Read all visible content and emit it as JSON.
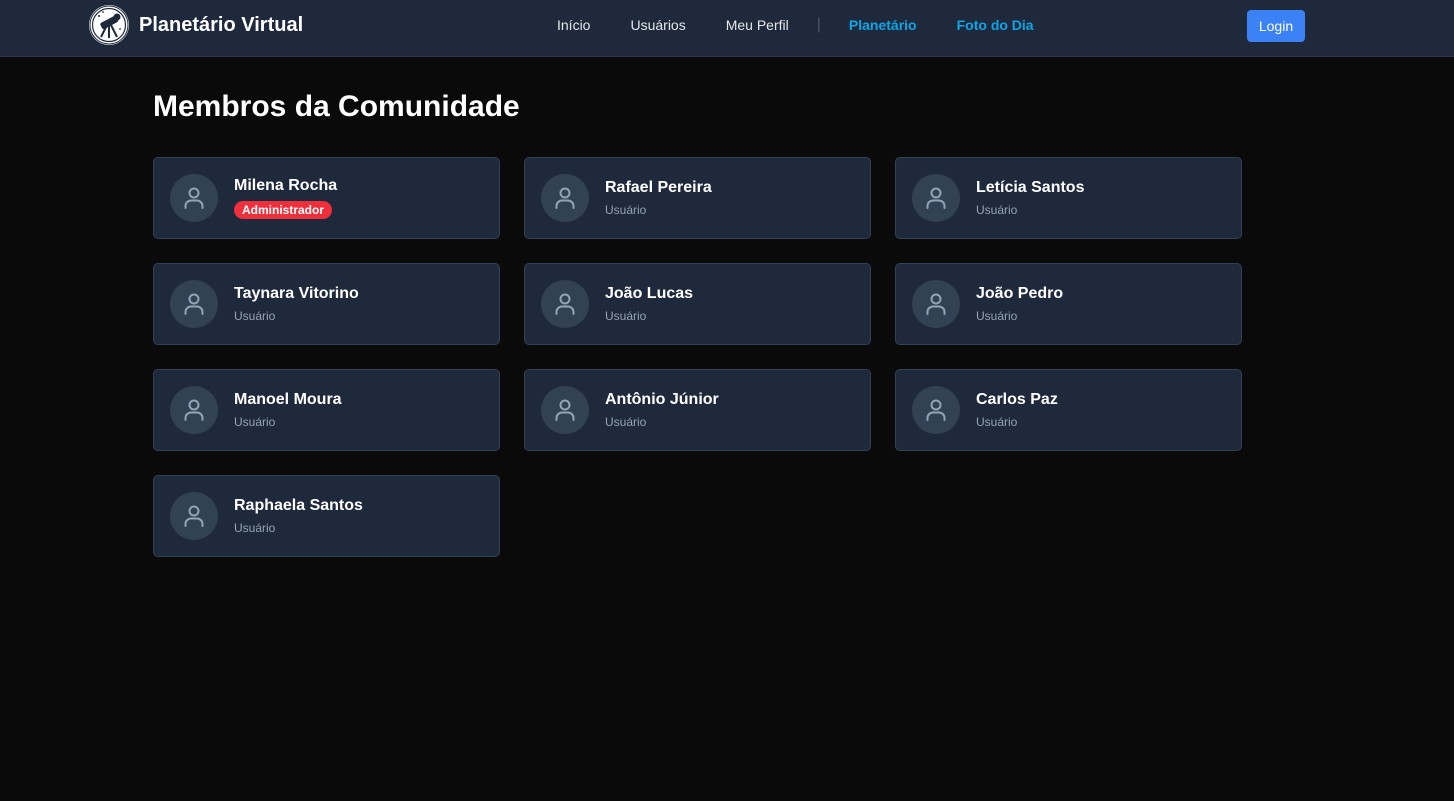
{
  "navbar": {
    "brand": "Planetário Virtual",
    "links": [
      {
        "label": "Início",
        "accent": false
      },
      {
        "label": "Usuários",
        "accent": false
      },
      {
        "label": "Meu Perfil",
        "accent": false
      },
      {
        "label": "Planetário",
        "accent": true
      },
      {
        "label": "Foto do Dia",
        "accent": true
      }
    ],
    "separator": "|",
    "login_label": "Login"
  },
  "main": {
    "title": "Membros da Comunidade",
    "members": [
      {
        "name": "Milena Rocha",
        "role": "Administrador",
        "admin": true
      },
      {
        "name": "Rafael Pereira",
        "role": "Usuário",
        "admin": false
      },
      {
        "name": "Letícia Santos",
        "role": "Usuário",
        "admin": false
      },
      {
        "name": "Taynara Vitorino",
        "role": "Usuário",
        "admin": false
      },
      {
        "name": "João Lucas",
        "role": "Usuário",
        "admin": false
      },
      {
        "name": "João Pedro",
        "role": "Usuário",
        "admin": false
      },
      {
        "name": "Manoel Moura",
        "role": "Usuário",
        "admin": false
      },
      {
        "name": "Antônio Júnior",
        "role": "Usuário",
        "admin": false
      },
      {
        "name": "Carlos Paz",
        "role": "Usuário",
        "admin": false
      },
      {
        "name": "Raphaela Santos",
        "role": "Usuário",
        "admin": false
      }
    ]
  },
  "icons": {
    "logo": "telescope-icon",
    "avatar": "user-icon"
  },
  "colors": {
    "background": "#0a0a0a",
    "navbar": "#1e293b",
    "card": "#1e293b",
    "accent_link": "#0ea5e9",
    "login_button": "#3b82f6",
    "admin_badge": "#ef2f3b"
  }
}
